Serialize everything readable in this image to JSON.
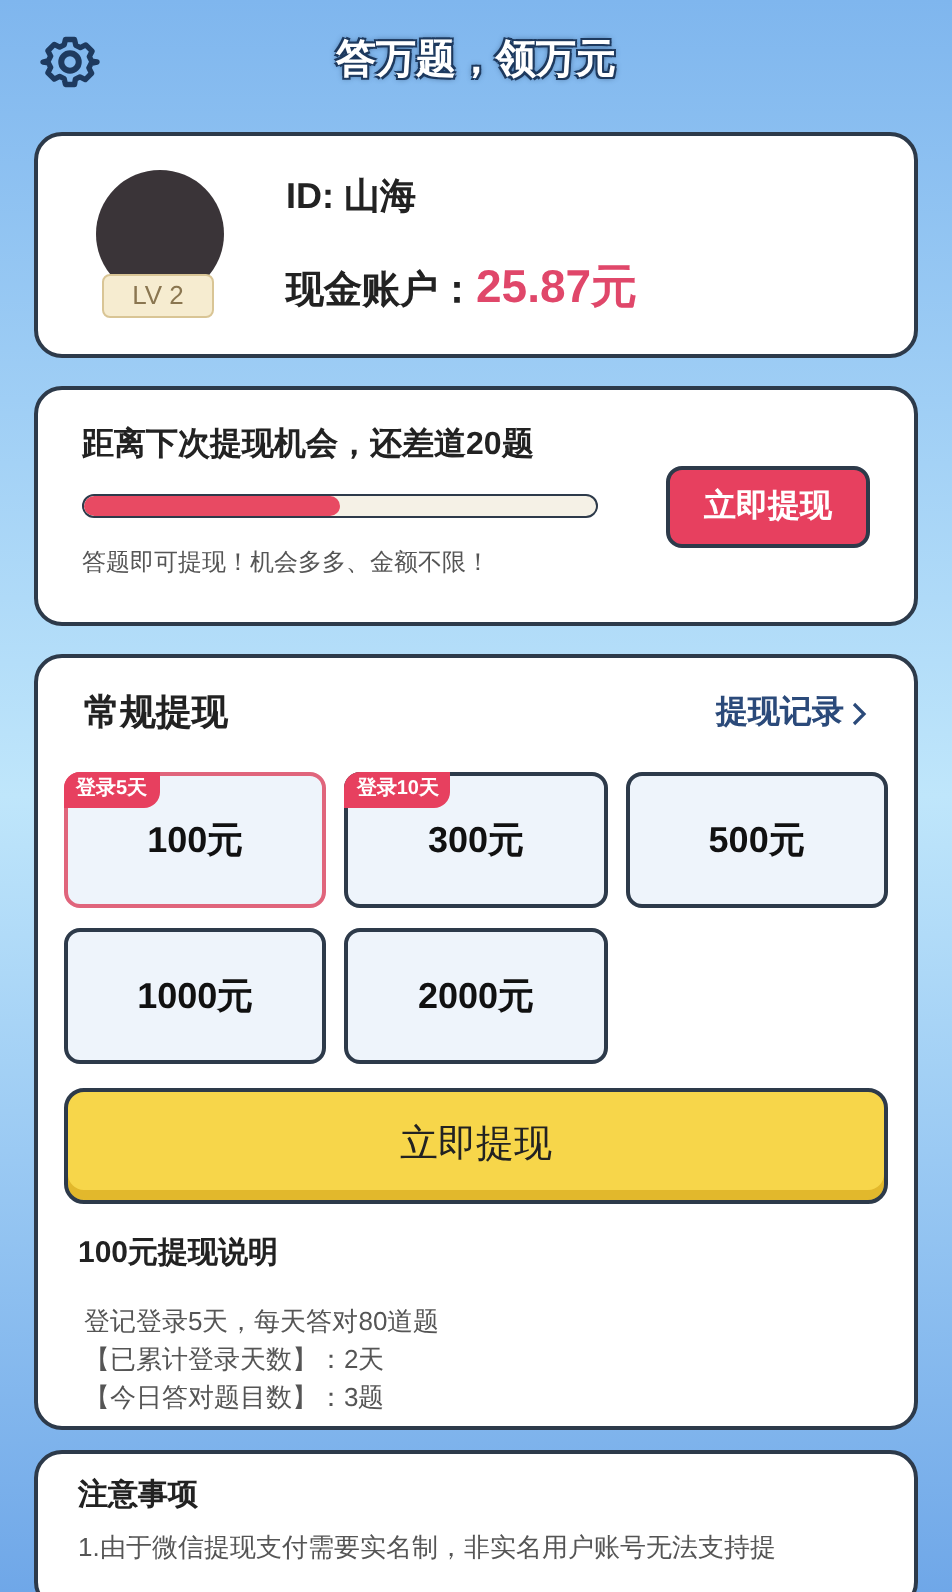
{
  "header": {
    "title": "答万题，领万元"
  },
  "profile": {
    "level_badge": "LV 2",
    "id_line": "ID: 山海",
    "balance_label": "现金账户：",
    "balance": "25.87元"
  },
  "progress": {
    "title": "距离下次提现机会，还差道**20**题",
    "level": 0.5,
    "button": "立即提现",
    "note": "答题即可提现！机会多多、金额不限！"
  },
  "withdraw": {
    "title": "常规提现",
    "records_link": "提现记录",
    "options": [
      {
        "amount": "100元",
        "tag": "登录5天",
        "selected": true
      },
      {
        "amount": "300元",
        "tag": "登录10天",
        "selected": false
      },
      {
        "amount": "500元",
        "selected": false
      },
      {
        "amount": "1000元",
        "selected": false
      },
      {
        "amount": "2000元",
        "selected": false
      }
    ],
    "button": "立即提现",
    "explain_title": "100元提现说明",
    "explain_lines": [
      "登记登录5天，每天答对80道题",
      "【已累计登录天数】：2天",
      "【今日答对题目数】：3题"
    ]
  },
  "notice": {
    "title": "注意事项",
    "text": "1.由于微信提现支付需要实名制，非实名用户账号无法支持提"
  }
}
